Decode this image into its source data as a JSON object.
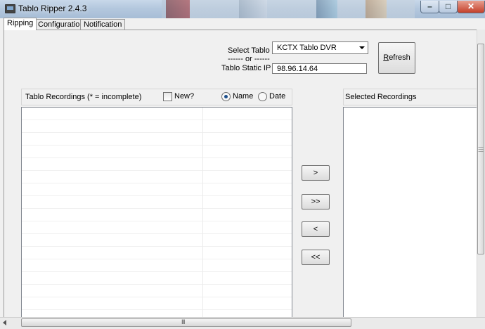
{
  "window": {
    "title": "Tablo Ripper 2.4.3",
    "minimize_glyph": "–",
    "maximize_glyph": "□",
    "close_glyph": "✕"
  },
  "tabs": [
    {
      "label": "Ripping",
      "active": true
    },
    {
      "label": "Configuration",
      "active": false
    },
    {
      "label": "Notification",
      "active": false
    }
  ],
  "connection": {
    "select_label": "Select Tablo",
    "or_divider": "------ or ------",
    "static_ip_label": "Tablo Static IP",
    "selected_tablo": "KCTX Tablo DVR",
    "static_ip_value": "98.96.14.64",
    "refresh_label": "Refresh"
  },
  "recordings": {
    "title": "Tablo Recordings (* = incomplete)",
    "new_label": "New?",
    "new_checked": false,
    "sort_name_label": "Name",
    "sort_date_label": "Date",
    "sort_selected": "Name",
    "items": []
  },
  "selected": {
    "title": "Selected Recordings",
    "items": []
  },
  "transfer_buttons": {
    "add": ">",
    "add_all": ">>",
    "remove": "<",
    "remove_all": "<<"
  },
  "scrollbar": {
    "grip_glyph": "III"
  },
  "icons": {
    "app": "tv-icon",
    "dropdown": "chevron-down-icon",
    "scroll_left": "arrow-left-icon"
  }
}
